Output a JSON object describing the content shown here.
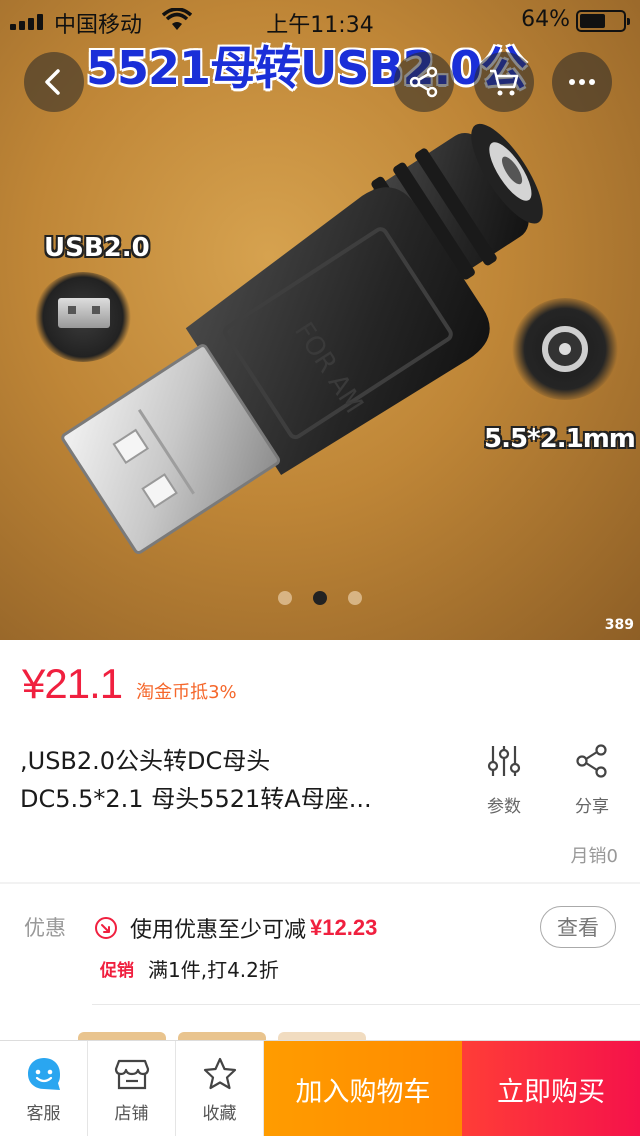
{
  "status_bar": {
    "carrier": "中国移动",
    "time": "上午11:34",
    "battery_pct": "64%",
    "battery_level": 0.64
  },
  "hero": {
    "banner_text": "5521母转USB2.0公",
    "usb_label": "USB2.0",
    "dc_label": "5.5*2.1mm",
    "image_counter": "389",
    "carousel_total": 3,
    "carousel_active": 2
  },
  "nav": {
    "back_icon": "chevron-left-icon",
    "share_icon": "share-icon",
    "cart_icon": "cart-icon",
    "more_icon": "more-icon"
  },
  "product": {
    "price": "¥21.1",
    "coin_deduct": "淘金币抵3%",
    "title_line1": ",USB2.0公头转DC母头",
    "title_line2": "DC5.5*2.1 母头5521转A母座...",
    "params_label": "参数",
    "share_label": "分享",
    "monthly_sales": "月销0"
  },
  "promo": {
    "label": "优惠",
    "coupon_text": "使用优惠至少可减",
    "coupon_amount": "¥12.23",
    "promo_tag": "促销",
    "promo_text": "满1件,打4.2折",
    "view_button": "查看"
  },
  "bottom_bar": {
    "service_label": "客服",
    "store_label": "店铺",
    "favorite_label": "收藏",
    "add_to_cart": "加入购物车",
    "buy_now": "立即购买"
  },
  "colors": {
    "price_red": "#f0203f",
    "coin_orange": "#f5672b",
    "cart_orange": "#ff9000",
    "buy_red": "#f5124a",
    "banner_blue": "#1a2fd8",
    "service_blue": "#2aa6f0"
  }
}
